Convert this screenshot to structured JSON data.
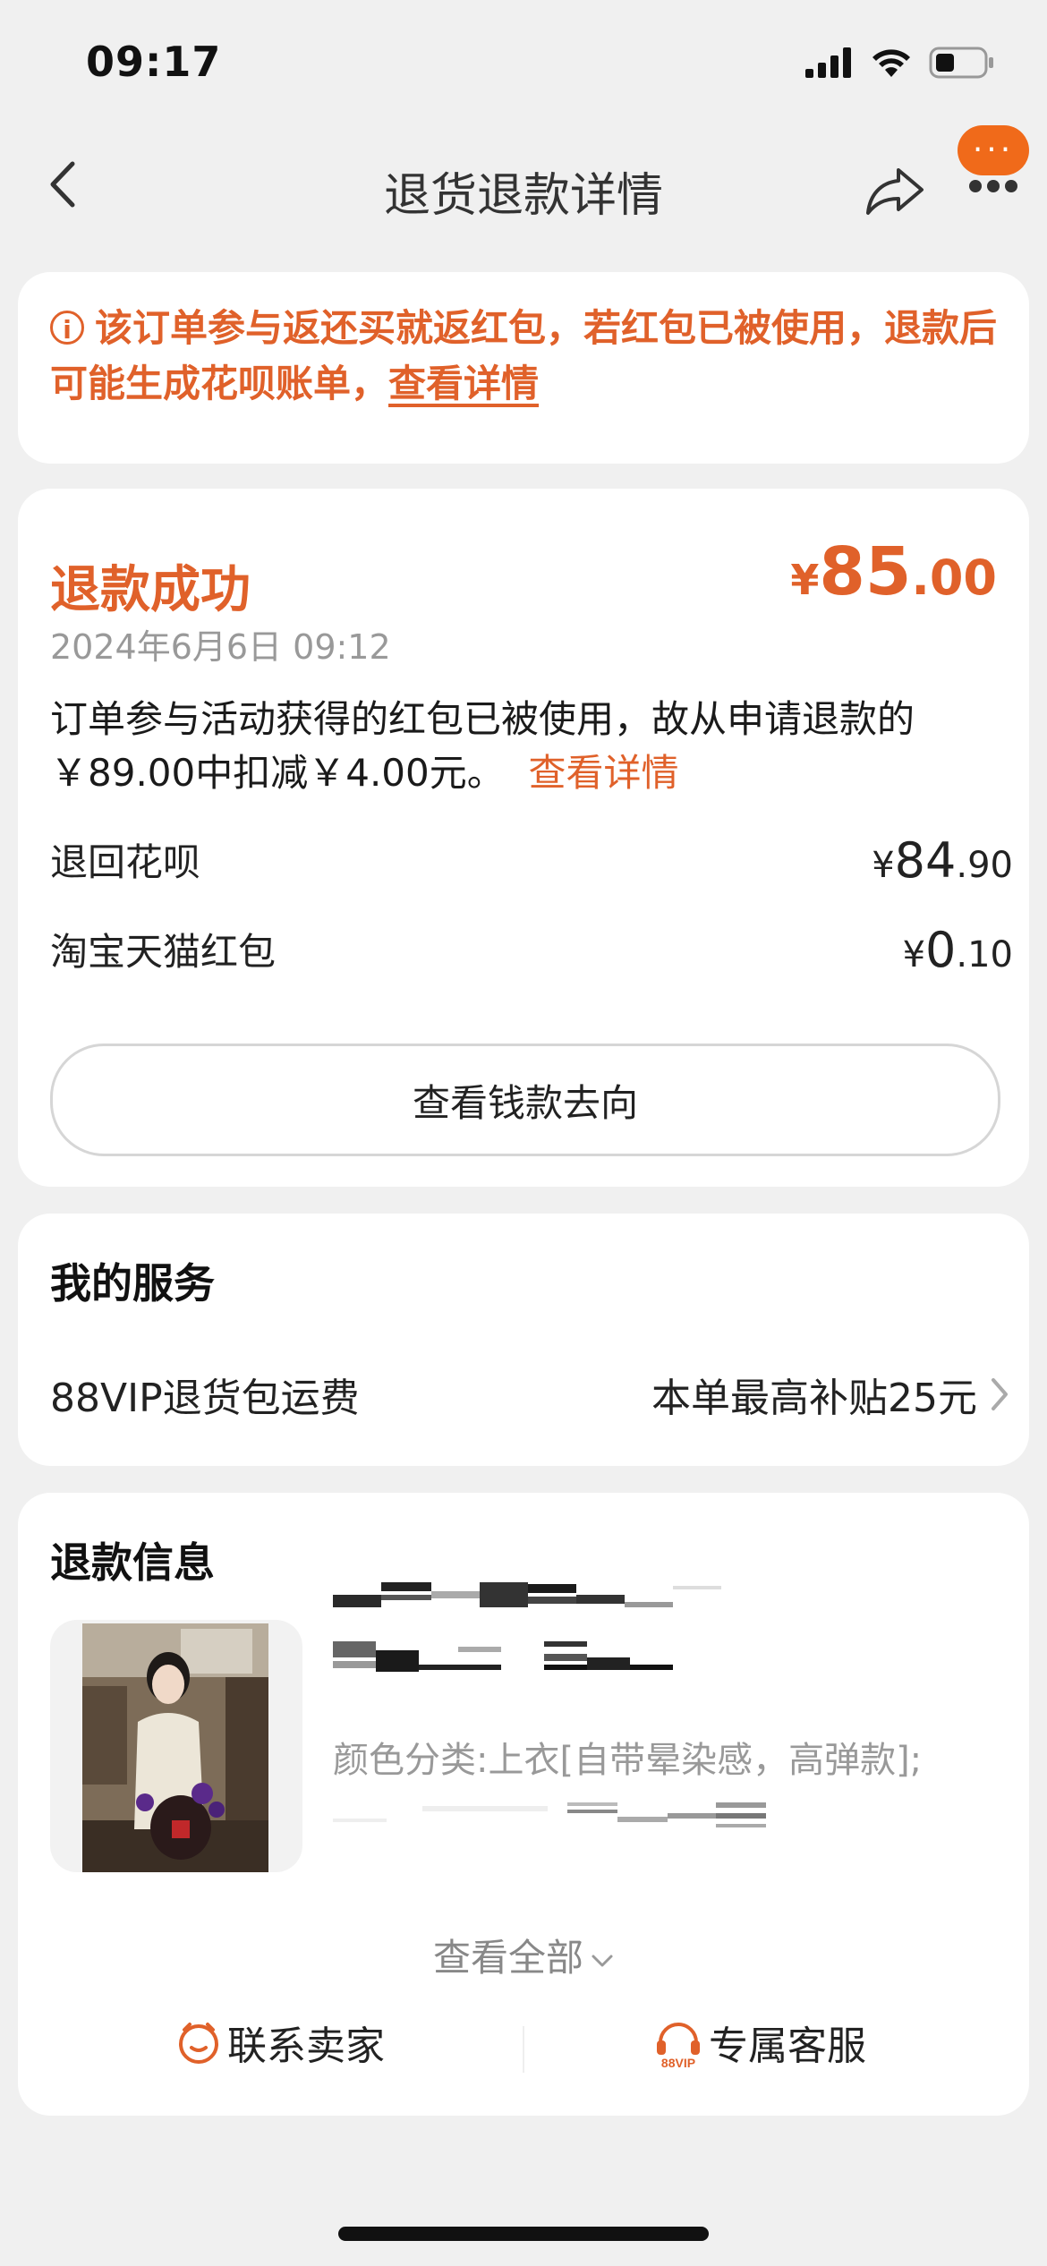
{
  "status_bar": {
    "time": "09:17"
  },
  "nav": {
    "title": "退货退款详情",
    "more_label": "···"
  },
  "notice": {
    "icon": "i",
    "text": "该订单参与返还买就返红包，若红包已被使用，退款后可能生成花呗账单，",
    "link": "查看详情"
  },
  "refund": {
    "status": "退款成功",
    "amount_currency": "¥",
    "amount_int": "85",
    "amount_dec": ".00",
    "time": "2024年6月6日 09:12",
    "desc": "订单参与活动获得的红包已被使用，故从申请退款的￥89.00中扣减￥4.00元。",
    "desc_link": "查看详情",
    "rows": [
      {
        "label": "退回花呗",
        "currency": "¥",
        "int": "84",
        "dec": ".90"
      },
      {
        "label": "淘宝天猫红包",
        "currency": "¥",
        "int": "0",
        "dec": ".10"
      }
    ],
    "button": "查看钱款去向"
  },
  "service": {
    "title": "我的服务",
    "item_label": "88VIP退货包运费",
    "item_value": "本单最高补贴25元"
  },
  "refund_info": {
    "title": "退款信息",
    "spec": "颜色分类:上衣[自带晕染感，高弹款];",
    "see_all": "查看全部",
    "contact_seller": "联系卖家",
    "exclusive_service": "专属客服",
    "vip_badge": "88VIP"
  },
  "colors": {
    "accent": "#e0612a",
    "more_bubble": "#f06a1a"
  }
}
